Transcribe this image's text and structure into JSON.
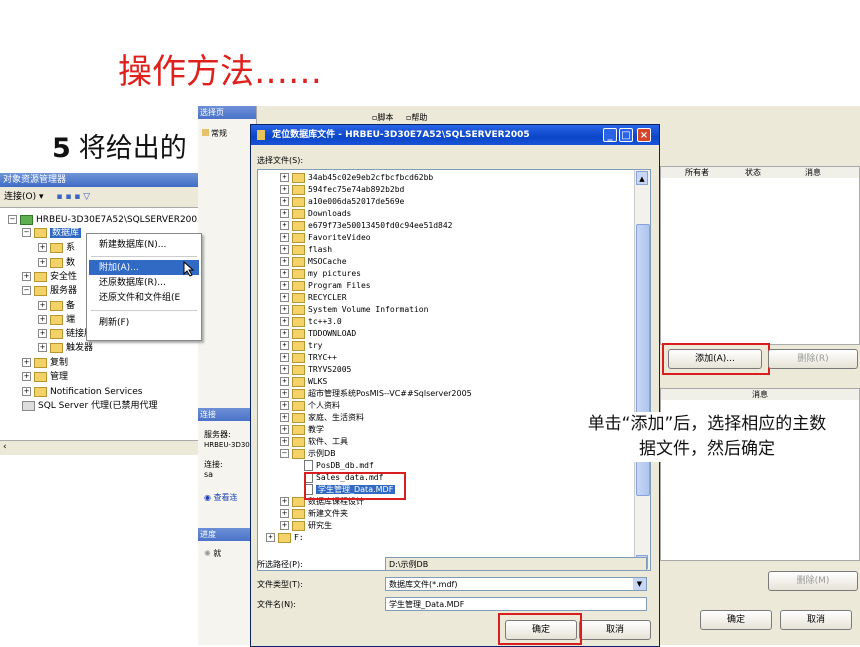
{
  "slide": {
    "title": "操作方法……",
    "step_number": "5",
    "step_text": "将给出的"
  },
  "object_explorer": {
    "title": "对象资源管理器",
    "connect_label": "连接(O) ▾",
    "tree": [
      {
        "label": "HRBEU-3D30E7A52\\SQLSERVER2005"
      },
      {
        "label": "数据库"
      },
      {
        "label": "系"
      },
      {
        "label": "数"
      },
      {
        "label": "安全性"
      },
      {
        "label": "服务器"
      },
      {
        "label": "备"
      },
      {
        "label": "端"
      },
      {
        "label": "链接服务器"
      },
      {
        "label": "触发器"
      },
      {
        "label": "复制"
      },
      {
        "label": "管理"
      },
      {
        "label": "Notification Services"
      },
      {
        "label": "SQL Server 代理(已禁用代理"
      }
    ]
  },
  "context_menu": {
    "items": [
      "新建数据库(N)...",
      "附加(A)...",
      "还原数据库(R)...",
      "还原文件和文件组(E",
      "刷新(F)"
    ]
  },
  "attach_dialog": {
    "side_headers": [
      "选择页",
      "连接",
      "进度"
    ],
    "side_items": [
      "常规"
    ],
    "toolbar": [
      "脚本",
      "帮助"
    ],
    "connection": {
      "server_label": "服务器:",
      "server_value": "HRBEU-3D30",
      "conn_label": "连接:",
      "conn_value": "sa",
      "view_label": "查看连"
    },
    "progress_label": "就",
    "grid_columns": [
      "所有者",
      "状态",
      "消息"
    ],
    "add_button": "添加(A)...",
    "remove_button": "删除(R)",
    "detail_header": "消息",
    "remove_button2": "删除(M)",
    "ok_button": "确定",
    "cancel_button": "取消"
  },
  "locate_dialog": {
    "title": "定位数据库文件 - HRBEU-3D30E7A52\\SQLSERVER2005",
    "select_file_label": "选择文件(S):",
    "files": [
      {
        "name": "34ab45c02e9eb2cfbcfbcd62bb",
        "cjk": false
      },
      {
        "name": "594fec75e74ab892b2bd",
        "cjk": false
      },
      {
        "name": "a10e006da52017de569e",
        "cjk": false
      },
      {
        "name": "Downloads",
        "cjk": false
      },
      {
        "name": "e679f73e50013450fd0c94ee51d842",
        "cjk": false
      },
      {
        "name": "FavoriteVideo",
        "cjk": false
      },
      {
        "name": "flash",
        "cjk": false
      },
      {
        "name": "MSOCache",
        "cjk": false
      },
      {
        "name": "my pictures",
        "cjk": false
      },
      {
        "name": "Program Files",
        "cjk": false
      },
      {
        "name": "RECYCLER",
        "cjk": false
      },
      {
        "name": "System Volume Information",
        "cjk": false
      },
      {
        "name": "tc++3.0",
        "cjk": false
      },
      {
        "name": "TDDOWNLOAD",
        "cjk": false
      },
      {
        "name": "try",
        "cjk": false
      },
      {
        "name": "TRYC++",
        "cjk": false
      },
      {
        "name": "TRYVS2005",
        "cjk": false
      },
      {
        "name": "WLKS",
        "cjk": false
      },
      {
        "name": "超市管理系统PosMIS--VC##Sqlserver2005",
        "cjk": true
      },
      {
        "name": "个人资料",
        "cjk": true
      },
      {
        "name": "家庭、生活资料",
        "cjk": true
      },
      {
        "name": "教学",
        "cjk": true
      },
      {
        "name": "软件、工具",
        "cjk": true
      },
      {
        "name": "示例DB",
        "cjk": true
      }
    ],
    "subfiles": [
      "PosDB_db.mdf",
      "Sales_data.mdf",
      "学生管理_Data.MDF"
    ],
    "after_files": [
      "数据库课程设计",
      "新建文件夹",
      "研究生"
    ],
    "drive": "F:",
    "path_label": "所选路径(P):",
    "path_value": "D:\\示例DB",
    "type_label": "文件类型(T):",
    "type_value": "数据库文件(*.mdf)",
    "name_label": "文件名(N):",
    "name_value": "学生管理_Data.MDF",
    "ok_button": "确定",
    "cancel_button": "取消"
  },
  "callout": {
    "text": "单击“添加”后，选择相应的主数据文件，然后确定"
  }
}
